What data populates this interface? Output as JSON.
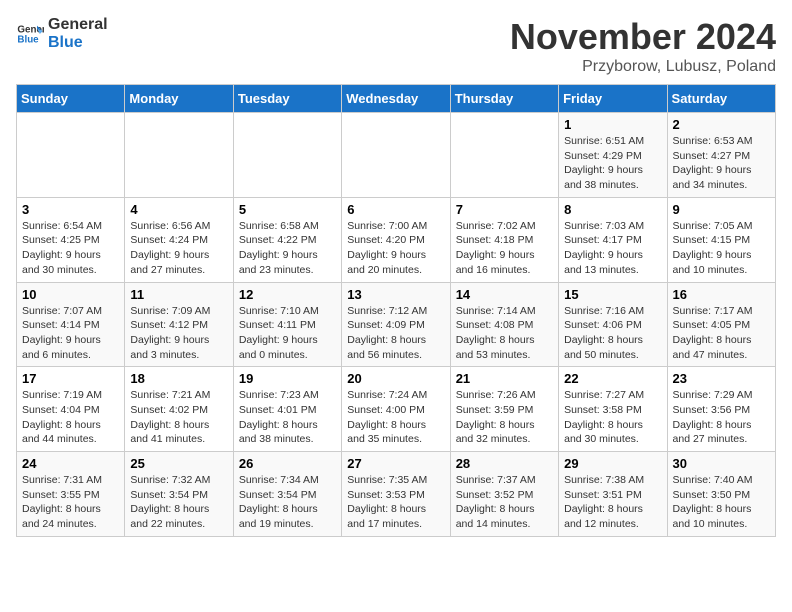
{
  "logo": {
    "line1": "General",
    "line2": "Blue"
  },
  "header": {
    "month": "November 2024",
    "location": "Przyborow, Lubusz, Poland"
  },
  "weekdays": [
    "Sunday",
    "Monday",
    "Tuesday",
    "Wednesday",
    "Thursday",
    "Friday",
    "Saturday"
  ],
  "weeks": [
    [
      {
        "day": "",
        "info": ""
      },
      {
        "day": "",
        "info": ""
      },
      {
        "day": "",
        "info": ""
      },
      {
        "day": "",
        "info": ""
      },
      {
        "day": "",
        "info": ""
      },
      {
        "day": "1",
        "info": "Sunrise: 6:51 AM\nSunset: 4:29 PM\nDaylight: 9 hours\nand 38 minutes."
      },
      {
        "day": "2",
        "info": "Sunrise: 6:53 AM\nSunset: 4:27 PM\nDaylight: 9 hours\nand 34 minutes."
      }
    ],
    [
      {
        "day": "3",
        "info": "Sunrise: 6:54 AM\nSunset: 4:25 PM\nDaylight: 9 hours\nand 30 minutes."
      },
      {
        "day": "4",
        "info": "Sunrise: 6:56 AM\nSunset: 4:24 PM\nDaylight: 9 hours\nand 27 minutes."
      },
      {
        "day": "5",
        "info": "Sunrise: 6:58 AM\nSunset: 4:22 PM\nDaylight: 9 hours\nand 23 minutes."
      },
      {
        "day": "6",
        "info": "Sunrise: 7:00 AM\nSunset: 4:20 PM\nDaylight: 9 hours\nand 20 minutes."
      },
      {
        "day": "7",
        "info": "Sunrise: 7:02 AM\nSunset: 4:18 PM\nDaylight: 9 hours\nand 16 minutes."
      },
      {
        "day": "8",
        "info": "Sunrise: 7:03 AM\nSunset: 4:17 PM\nDaylight: 9 hours\nand 13 minutes."
      },
      {
        "day": "9",
        "info": "Sunrise: 7:05 AM\nSunset: 4:15 PM\nDaylight: 9 hours\nand 10 minutes."
      }
    ],
    [
      {
        "day": "10",
        "info": "Sunrise: 7:07 AM\nSunset: 4:14 PM\nDaylight: 9 hours\nand 6 minutes."
      },
      {
        "day": "11",
        "info": "Sunrise: 7:09 AM\nSunset: 4:12 PM\nDaylight: 9 hours\nand 3 minutes."
      },
      {
        "day": "12",
        "info": "Sunrise: 7:10 AM\nSunset: 4:11 PM\nDaylight: 9 hours\nand 0 minutes."
      },
      {
        "day": "13",
        "info": "Sunrise: 7:12 AM\nSunset: 4:09 PM\nDaylight: 8 hours\nand 56 minutes."
      },
      {
        "day": "14",
        "info": "Sunrise: 7:14 AM\nSunset: 4:08 PM\nDaylight: 8 hours\nand 53 minutes."
      },
      {
        "day": "15",
        "info": "Sunrise: 7:16 AM\nSunset: 4:06 PM\nDaylight: 8 hours\nand 50 minutes."
      },
      {
        "day": "16",
        "info": "Sunrise: 7:17 AM\nSunset: 4:05 PM\nDaylight: 8 hours\nand 47 minutes."
      }
    ],
    [
      {
        "day": "17",
        "info": "Sunrise: 7:19 AM\nSunset: 4:04 PM\nDaylight: 8 hours\nand 44 minutes."
      },
      {
        "day": "18",
        "info": "Sunrise: 7:21 AM\nSunset: 4:02 PM\nDaylight: 8 hours\nand 41 minutes."
      },
      {
        "day": "19",
        "info": "Sunrise: 7:23 AM\nSunset: 4:01 PM\nDaylight: 8 hours\nand 38 minutes."
      },
      {
        "day": "20",
        "info": "Sunrise: 7:24 AM\nSunset: 4:00 PM\nDaylight: 8 hours\nand 35 minutes."
      },
      {
        "day": "21",
        "info": "Sunrise: 7:26 AM\nSunset: 3:59 PM\nDaylight: 8 hours\nand 32 minutes."
      },
      {
        "day": "22",
        "info": "Sunrise: 7:27 AM\nSunset: 3:58 PM\nDaylight: 8 hours\nand 30 minutes."
      },
      {
        "day": "23",
        "info": "Sunrise: 7:29 AM\nSunset: 3:56 PM\nDaylight: 8 hours\nand 27 minutes."
      }
    ],
    [
      {
        "day": "24",
        "info": "Sunrise: 7:31 AM\nSunset: 3:55 PM\nDaylight: 8 hours\nand 24 minutes."
      },
      {
        "day": "25",
        "info": "Sunrise: 7:32 AM\nSunset: 3:54 PM\nDaylight: 8 hours\nand 22 minutes."
      },
      {
        "day": "26",
        "info": "Sunrise: 7:34 AM\nSunset: 3:54 PM\nDaylight: 8 hours\nand 19 minutes."
      },
      {
        "day": "27",
        "info": "Sunrise: 7:35 AM\nSunset: 3:53 PM\nDaylight: 8 hours\nand 17 minutes."
      },
      {
        "day": "28",
        "info": "Sunrise: 7:37 AM\nSunset: 3:52 PM\nDaylight: 8 hours\nand 14 minutes."
      },
      {
        "day": "29",
        "info": "Sunrise: 7:38 AM\nSunset: 3:51 PM\nDaylight: 8 hours\nand 12 minutes."
      },
      {
        "day": "30",
        "info": "Sunrise: 7:40 AM\nSunset: 3:50 PM\nDaylight: 8 hours\nand 10 minutes."
      }
    ]
  ]
}
